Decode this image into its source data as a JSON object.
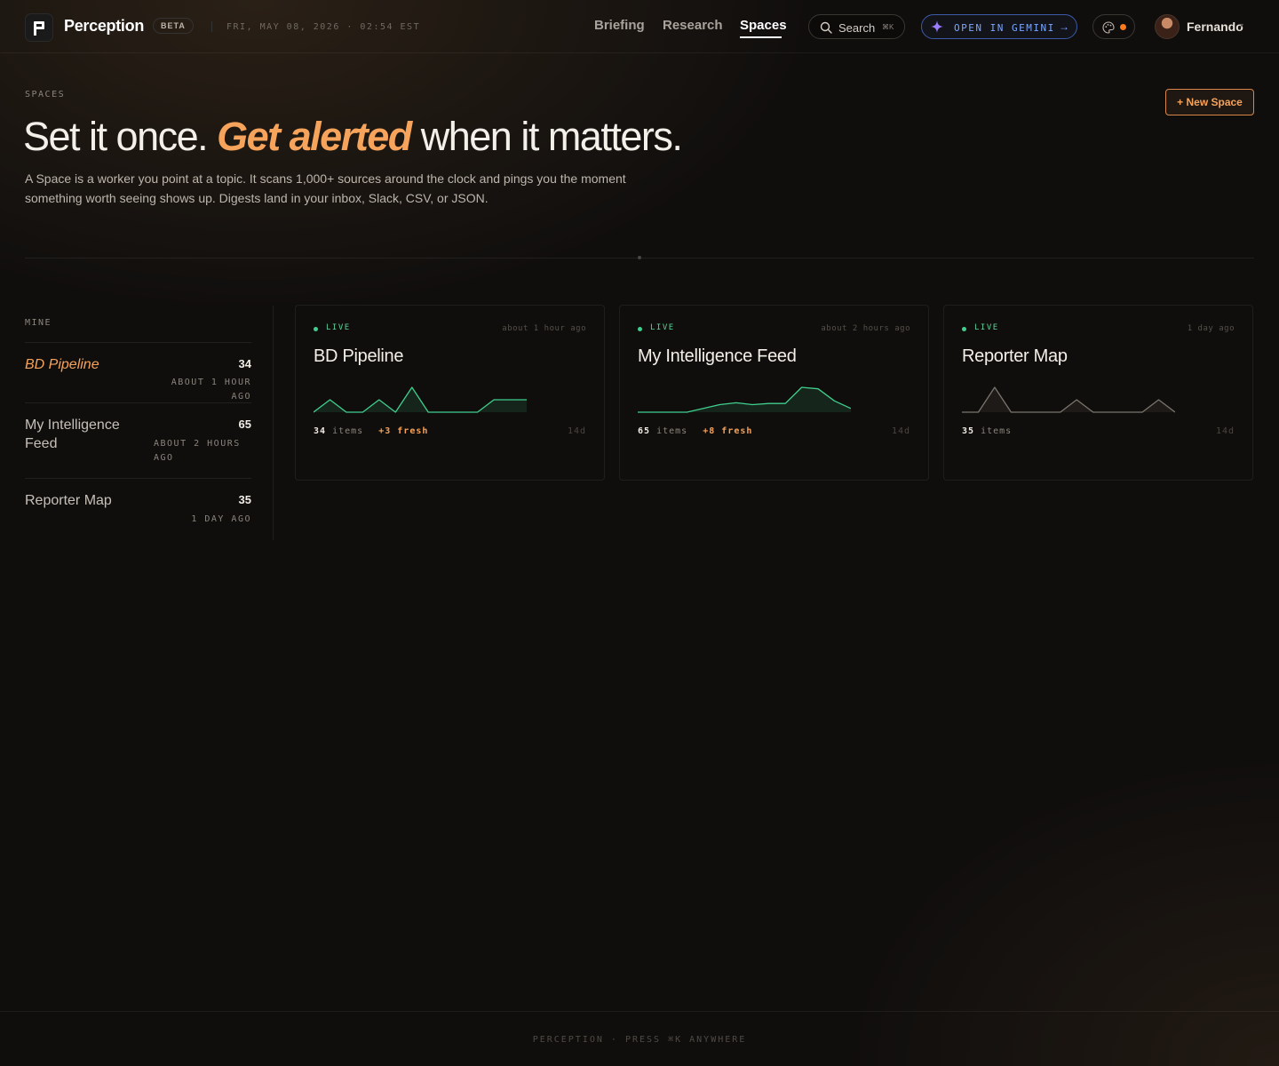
{
  "header": {
    "brand": "Perception",
    "badge": "BETA",
    "date": "FRI, MAY 08, 2026 · 02:54 EST",
    "nav": [
      {
        "label": "Briefing",
        "active": false
      },
      {
        "label": "Research",
        "active": false
      },
      {
        "label": "Spaces",
        "active": true
      }
    ],
    "search": {
      "label": "Search",
      "shortcut": "⌘K"
    },
    "gemini": {
      "label": "OPEN IN GEMINI",
      "arrow": "→"
    },
    "user": {
      "name": "Fernando"
    }
  },
  "hero": {
    "eyebrow": "SPACES",
    "headline_pre": "Set it once. ",
    "headline_accent": "Get alerted",
    "headline_post": " when it matters.",
    "description": "A Space is a worker you point at a topic. It scans 1,000+ sources around the clock and pings you the moment something worth seeing shows up. Digests land in your inbox, Slack, CSV, or JSON.",
    "new_space_button": "+ New Space"
  },
  "sidebar": {
    "title": "MINE",
    "items": [
      {
        "name": "BD Pipeline",
        "count": "34",
        "time": "ABOUT 1 HOUR AGO",
        "active": true
      },
      {
        "name": "My Intelligence Feed",
        "count": "65",
        "time": "ABOUT 2 HOURS AGO",
        "active": false
      },
      {
        "name": "Reporter Map",
        "count": "35",
        "time": "1 DAY AGO",
        "active": false
      }
    ]
  },
  "cards": [
    {
      "status": "LIVE",
      "time": "about 1 hour ago",
      "title": "BD Pipeline",
      "items_count": "34",
      "items_label": "items",
      "fresh": "+3 fresh",
      "range": "14d",
      "spark": [
        0,
        1,
        0,
        0,
        1,
        0,
        2,
        0,
        0,
        0,
        0,
        1,
        1,
        1
      ],
      "color": "#3fcf8e"
    },
    {
      "status": "LIVE",
      "time": "about 2 hours ago",
      "title": "My Intelligence Feed",
      "items_count": "65",
      "items_label": "items",
      "fresh": "+8 fresh",
      "range": "14d",
      "spark": [
        0,
        0,
        0,
        0,
        1,
        2,
        2.5,
        2,
        2.3,
        2.3,
        6.6,
        6.2,
        3,
        1
      ],
      "color": "#3fcf8e"
    },
    {
      "status": "LIVE",
      "time": "1 day ago",
      "title": "Reporter Map",
      "items_count": "35",
      "items_label": "items",
      "fresh": "",
      "range": "14d",
      "spark": [
        0,
        0,
        2,
        0,
        0,
        0,
        0,
        1,
        0,
        0,
        0,
        0,
        1,
        0
      ],
      "color": "#7a746d"
    }
  ],
  "footer": {
    "text": "PERCEPTION · PRESS ⌘K ANYWHERE"
  }
}
